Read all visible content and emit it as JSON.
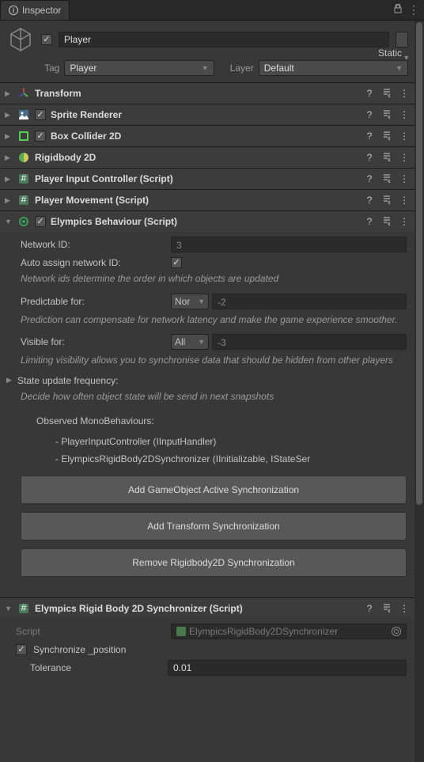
{
  "tab": {
    "title": "Inspector"
  },
  "gameObject": {
    "enabled": true,
    "name": "Player",
    "staticLabel": "Static",
    "tagLabel": "Tag",
    "tag": "Player",
    "layerLabel": "Layer",
    "layer": "Default"
  },
  "components": [
    {
      "title": "Transform",
      "hasCheckbox": false,
      "checked": false,
      "icon": "transform",
      "expanded": false
    },
    {
      "title": "Sprite Renderer",
      "hasCheckbox": true,
      "checked": true,
      "icon": "sprite",
      "expanded": false
    },
    {
      "title": "Box Collider 2D",
      "hasCheckbox": true,
      "checked": true,
      "icon": "boxcol",
      "expanded": false
    },
    {
      "title": "Rigidbody 2D",
      "hasCheckbox": false,
      "checked": false,
      "icon": "rigid",
      "expanded": false
    },
    {
      "title": "Player Input Controller (Script)",
      "hasCheckbox": false,
      "checked": false,
      "icon": "script",
      "expanded": false
    },
    {
      "title": "Player Movement (Script)",
      "hasCheckbox": false,
      "checked": false,
      "icon": "script",
      "expanded": false
    }
  ],
  "elympics": {
    "title": "Elympics Behaviour (Script)",
    "networkIdLabel": "Network ID:",
    "networkId": "3",
    "autoAssignLabel": "Auto assign network ID:",
    "autoAssign": true,
    "networkHelp": "Network ids determine the order in which objects are updated",
    "predictableLabel": "Predictable for:",
    "predictableOpt": "Nor",
    "predictableVal": "-2",
    "predictableHelp": "Prediction can compensate for network latency and make the game experience smoother.",
    "visibleLabel": "Visible for:",
    "visibleOpt": "All",
    "visibleVal": "-3",
    "visibleHelp": "Limiting visibility allows you to synchronise data that should be hidden from other players",
    "stateLabel": "State update frequency:",
    "stateHelp": "Decide how often object state will be send in next snapshots",
    "observedLabel": "Observed MonoBehaviours:",
    "observed": [
      "- PlayerInputController (IInputHandler)",
      "- ElympicsRigidBody2DSynchronizer (IInitializable, IStateSer"
    ],
    "buttons": [
      "Add GameObject Active Synchronization",
      "Add Transform Synchronization",
      "Remove Rigidbody2D Synchronization"
    ]
  },
  "synchronizer": {
    "title": "Elympics Rigid Body 2D Synchronizer (Script)",
    "scriptLabel": "Script",
    "scriptValue": "ElympicsRigidBody2DSynchronizer",
    "syncPosLabel": "Synchronize _position",
    "syncPos": true,
    "toleranceLabel": "Tolerance",
    "tolerance": "0.01"
  }
}
